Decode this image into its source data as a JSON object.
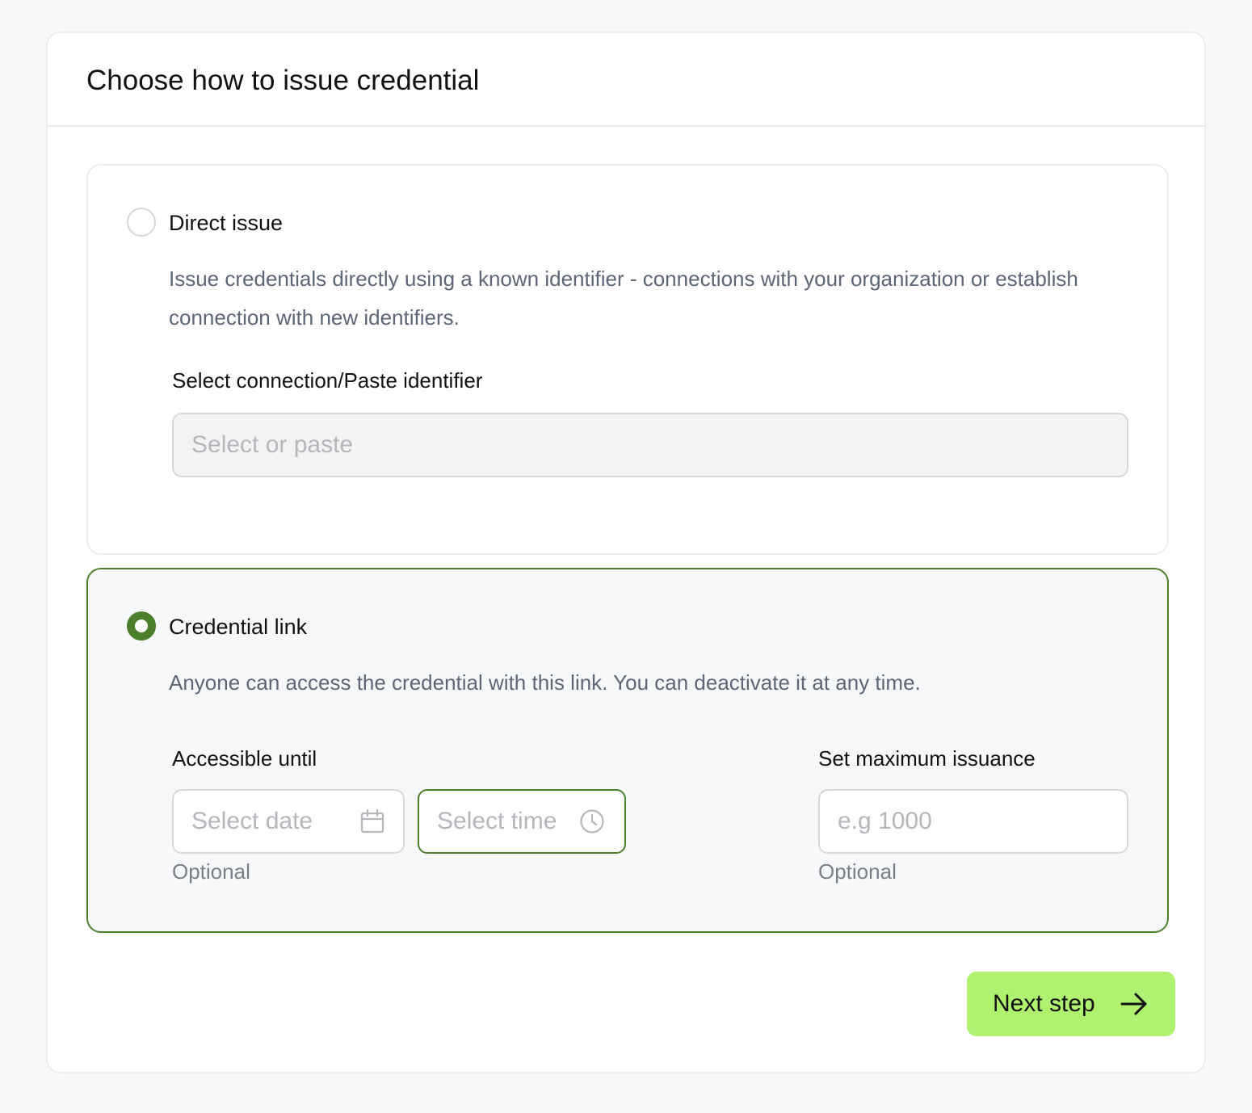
{
  "header": {
    "title": "Choose how to issue credential"
  },
  "direct_issue": {
    "title": "Direct issue",
    "description": "Issue credentials directly using a known identifier - connections with your organization or establish connection with new identifiers.",
    "selected": false,
    "connection_field": {
      "label": "Select connection/Paste identifier",
      "placeholder": "Select or paste",
      "disabled": true
    },
    "radio_icon": "radio-unchecked-icon"
  },
  "credential_link": {
    "title": "Credential link",
    "description": "Anyone can access the credential with this link. You can deactivate it at any time.",
    "selected": true,
    "radio_icon": "radio-checked-icon",
    "accessible_until": {
      "label": "Accessible until",
      "date_placeholder": "Select date",
      "date_icon": "calendar-icon",
      "time_placeholder": "Select time",
      "time_icon": "clock-icon",
      "helper": "Optional"
    },
    "max_issuance": {
      "label": "Set maximum issuance",
      "placeholder": "e.g 1000",
      "helper": "Optional"
    }
  },
  "actions": {
    "next_label": "Next step",
    "next_icon": "arrow-right-icon"
  },
  "colors": {
    "accent_green": "#4a7f2c",
    "button_green": "#aef26f",
    "background": "#f7f8f9"
  }
}
